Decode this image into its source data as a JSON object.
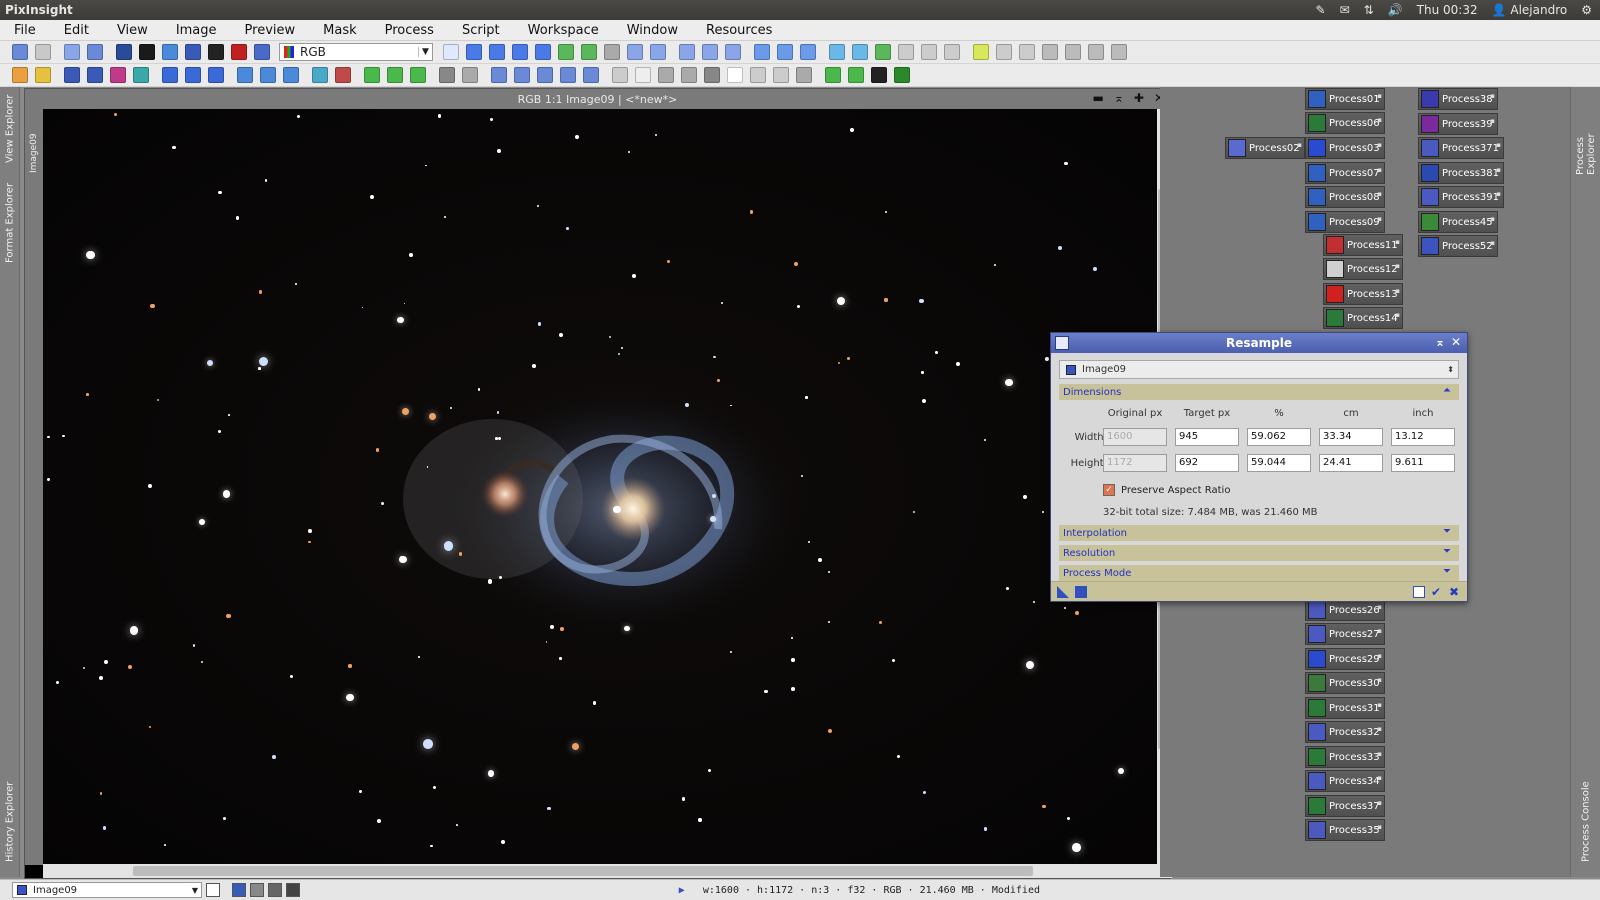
{
  "topbar": {
    "app_title": "PixInsight",
    "clock": "Thu 00:32",
    "user": "Alejandro"
  },
  "menu": [
    "File",
    "Edit",
    "View",
    "Image",
    "Preview",
    "Mask",
    "Process",
    "Script",
    "Workspace",
    "Window",
    "Resources"
  ],
  "toolbar": {
    "channel_select": "RGB"
  },
  "left_tabs": {
    "view_explorer": "View Explorer",
    "format_explorer": "Format Explorer",
    "history_explorer": "History Explorer",
    "view_tab": "Image09"
  },
  "right_tabs": {
    "process_explorer": "Process Explorer",
    "process_console": "Process Console"
  },
  "image_window": {
    "title": "RGB 1:1 Image09 | <*new*>"
  },
  "process_icons": [
    {
      "label": "Process01",
      "color": "#3060c0"
    },
    {
      "label": "Process06",
      "color": "#2a7a3a"
    },
    {
      "label": "Process02",
      "color": "#5a6ad0"
    },
    {
      "label": "Process03",
      "color": "#2a4ad0"
    },
    {
      "label": "Process07",
      "color": "#3060c0"
    },
    {
      "label": "Process08",
      "color": "#3060c0"
    },
    {
      "label": "Process09",
      "color": "#3060c0"
    },
    {
      "label": "Process11",
      "color": "#c03030"
    },
    {
      "label": "Process12",
      "color": "#d0d0d0"
    },
    {
      "label": "Process13",
      "color": "#d02020"
    },
    {
      "label": "Process14",
      "color": "#2a7a3a"
    },
    {
      "label": "Process38",
      "color": "#3a3ab0"
    },
    {
      "label": "Process39",
      "color": "#7a2a9a"
    },
    {
      "label": "Process371",
      "color": "#4a5ac0"
    },
    {
      "label": "Process381",
      "color": "#2a4ab0"
    },
    {
      "label": "Process391",
      "color": "#4a5ac0"
    },
    {
      "label": "Process45",
      "color": "#3a8a3a"
    },
    {
      "label": "Process52",
      "color": "#3b54c0"
    },
    {
      "label": "Process26",
      "color": "#4a5ac0"
    },
    {
      "label": "Process27",
      "color": "#4a5ac0"
    },
    {
      "label": "Process29",
      "color": "#2a4ad0"
    },
    {
      "label": "Process30",
      "color": "#3a7a3a"
    },
    {
      "label": "Process31",
      "color": "#2a7a3a"
    },
    {
      "label": "Process32",
      "color": "#4a5ac0"
    },
    {
      "label": "Process33",
      "color": "#2a7a3a"
    },
    {
      "label": "Process34",
      "color": "#4a5ac0"
    },
    {
      "label": "Process37",
      "color": "#2a7a3a"
    },
    {
      "label": "Process35",
      "color": "#4a5ac0"
    }
  ],
  "resample": {
    "title": "Resample",
    "view": "Image09",
    "sections": {
      "dimensions": "Dimensions",
      "interpolation": "Interpolation",
      "resolution": "Resolution",
      "process_mode": "Process Mode"
    },
    "columns": [
      "Original px",
      "Target px",
      "%",
      "cm",
      "inch"
    ],
    "rows": [
      {
        "label": "Width:",
        "original": "1600",
        "target": "945",
        "percent": "59.062",
        "cm": "33.34",
        "inch": "13.12"
      },
      {
        "label": "Height:",
        "original": "1172",
        "target": "692",
        "percent": "59.044",
        "cm": "24.41",
        "inch": "9.611"
      }
    ],
    "preserve_aspect": "Preserve Aspect Ratio",
    "size_info": "32-bit total size: 7.484 MB, was 21.460 MB"
  },
  "statusbar": {
    "view": "Image09",
    "info": "w:1600 · h:1172 · n:3 · f32 · RGB · 21.460 MB · Modified"
  }
}
